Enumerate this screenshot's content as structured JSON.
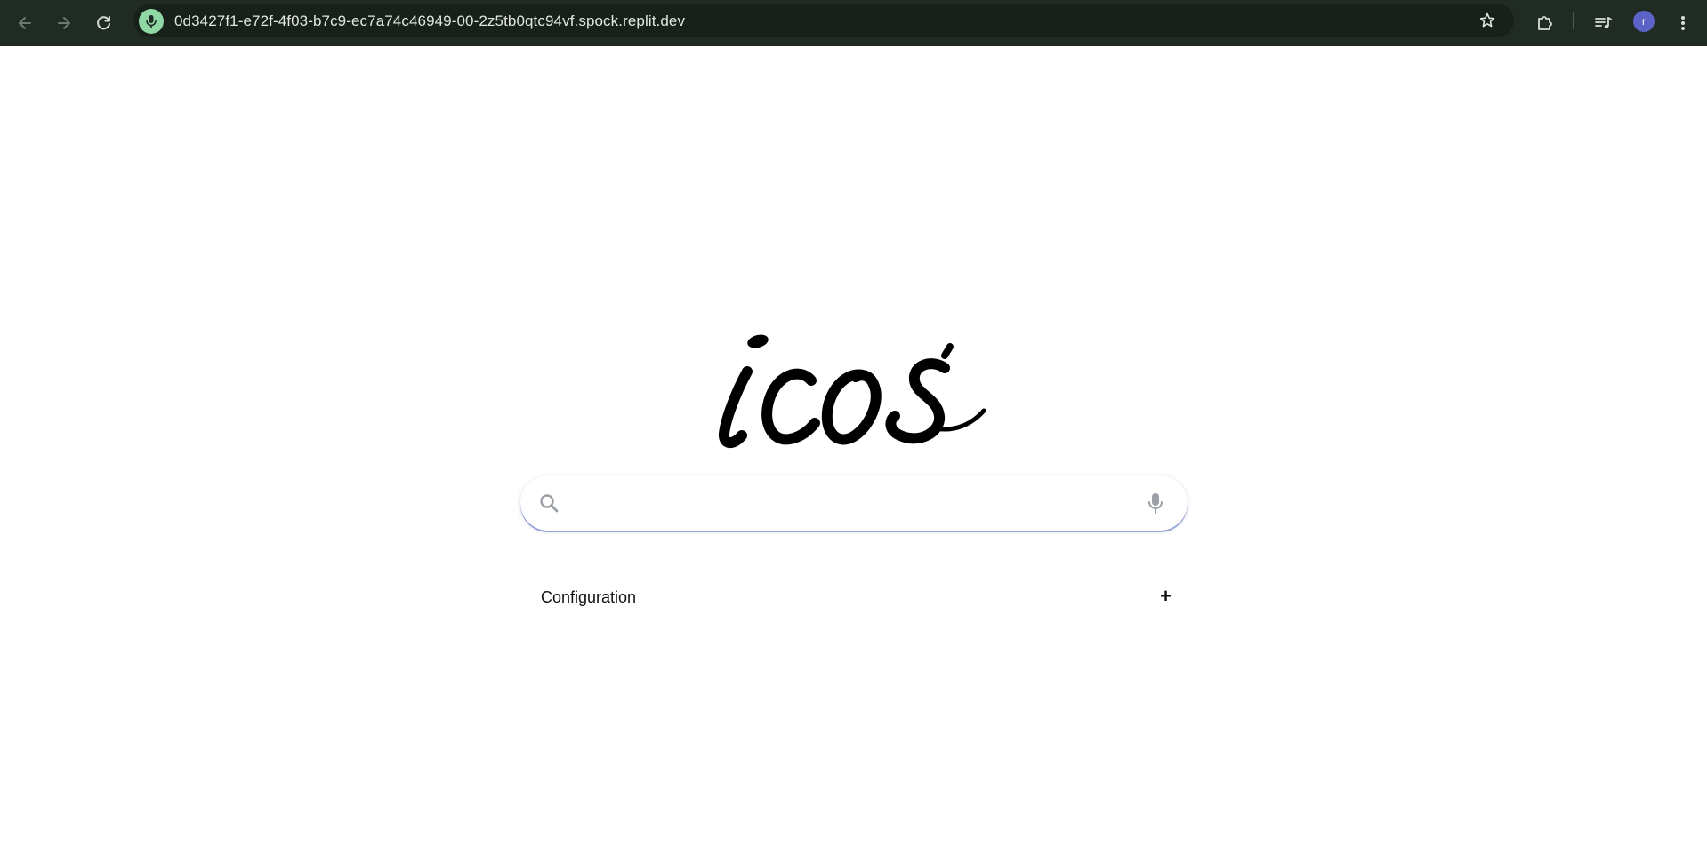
{
  "browser": {
    "url": "0d3427f1-e72f-4f03-b7c9-ec7a74c46949-00-2z5tb0qtc94vf.spock.replit.dev",
    "avatar_letter": "r",
    "accent_color": "#8fd7a5",
    "bar_color": "#1f2b23",
    "icons": [
      "back-arrow-icon",
      "forward-arrow-icon",
      "reload-icon",
      "mic-icon",
      "star-icon",
      "extensions-icon",
      "media-queue-icon",
      "more-vert-icon"
    ]
  },
  "logo": {
    "text": "icos"
  },
  "search": {
    "value": "",
    "placeholder": "",
    "icons": [
      "search-icon",
      "mic-icon"
    ]
  },
  "config": {
    "label": "Configuration",
    "toggle": "+"
  }
}
